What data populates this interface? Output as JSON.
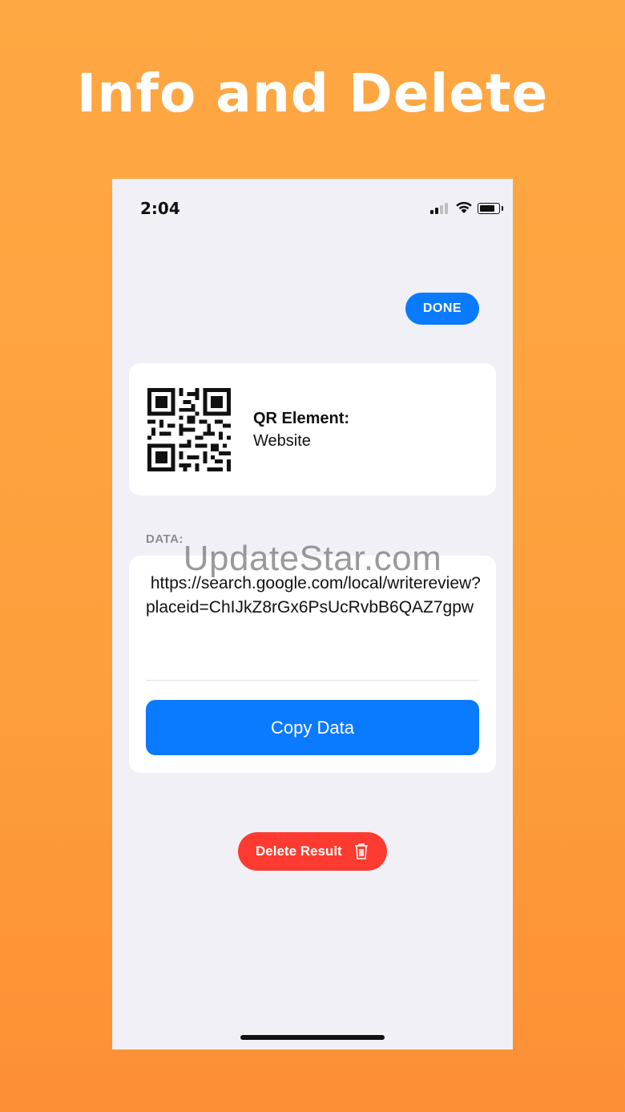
{
  "headline": "Info and Delete",
  "status_bar": {
    "time": "2:04",
    "icons": [
      "cellular-signal-icon",
      "wifi-icon",
      "battery-icon"
    ]
  },
  "header": {
    "done_label": "DONE"
  },
  "qr_card": {
    "element_label": "QR Element:",
    "element_value": "Website",
    "icon": "qr-code-image"
  },
  "data_section": {
    "label": "DATA:",
    "value": " https://search.google.com/local/writereview?placeid=ChIJkZ8rGx6PsUcRvbB6QAZ7gpw",
    "copy_label": "Copy Data"
  },
  "delete": {
    "label": "Delete Result",
    "icon": "trash-icon"
  },
  "watermark": "UpdateStar.com",
  "colors": {
    "accent_blue": "#0a7aff",
    "delete_red": "#fd3b30",
    "background_orange": "#fea843",
    "screen_bg": "#f1f0f6"
  }
}
